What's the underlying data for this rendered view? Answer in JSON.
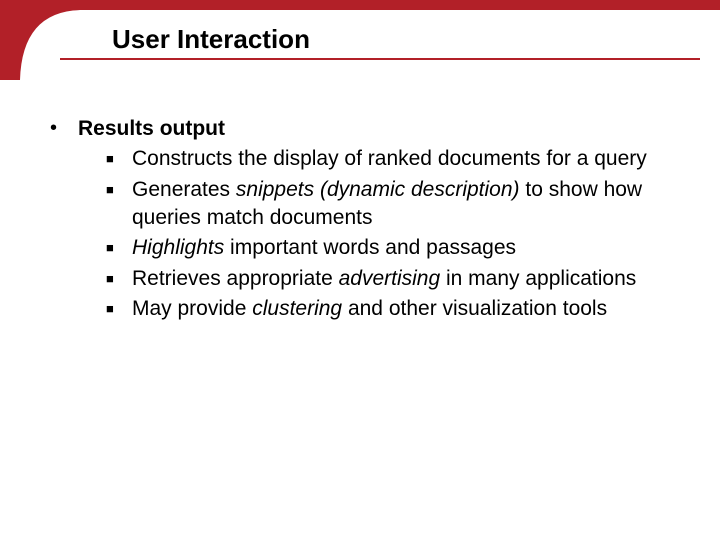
{
  "accent_color": "#b22028",
  "slide": {
    "title": "User Interaction",
    "bullet_level1": "Results output",
    "sub_bullets": [
      {
        "plain": "Constructs the display of ranked documents for a query"
      },
      {
        "html": "Generates <span class='em'>snippets (dynamic description)</span> to show how queries match documents"
      },
      {
        "html": "<span class='em'>Highlights</span> important words and passages"
      },
      {
        "html": "Retrieves appropriate <span class='em'>advertising</span> in many applications"
      },
      {
        "html": "May provide <span class='em'>clustering</span> and other visualization tools"
      }
    ]
  }
}
